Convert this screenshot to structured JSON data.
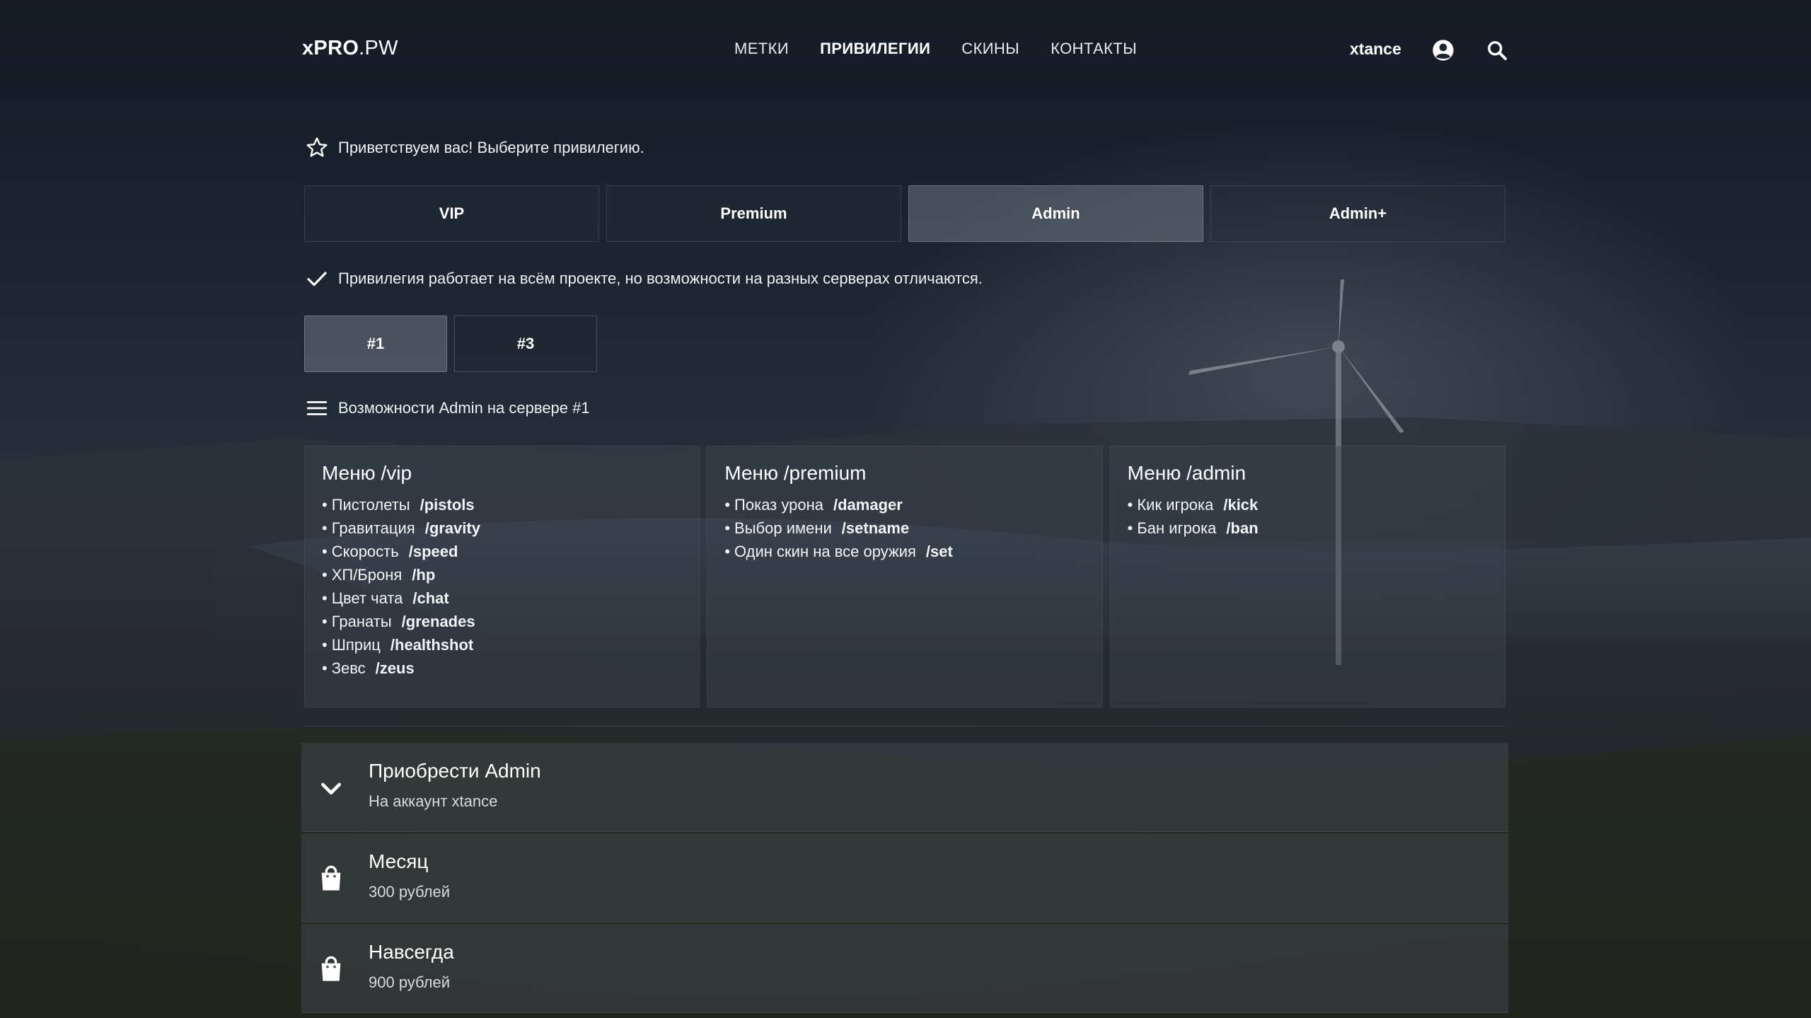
{
  "header": {
    "logo_bold": "xPRO",
    "logo_light": ".PW",
    "nav": [
      {
        "label": "МЕТКИ",
        "active": false
      },
      {
        "label": "ПРИВИЛЕГИИ",
        "active": true
      },
      {
        "label": "СКИНЫ",
        "active": false
      },
      {
        "label": "КОНТАКТЫ",
        "active": false
      }
    ],
    "username": "xtance",
    "user_icon": "account-circle-icon",
    "search_icon": "search-icon"
  },
  "greeting": {
    "icon": "star-outline-icon",
    "text": "Приветствуем вас! Выберите привилегию."
  },
  "tabs": [
    {
      "label": "VIP",
      "active": false
    },
    {
      "label": "Premium",
      "active": false
    },
    {
      "label": "Admin",
      "active": true
    },
    {
      "label": "Admin+",
      "active": false
    }
  ],
  "notice": {
    "icon": "checkmark-icon",
    "text": "Привилегия работает на всём проекте, но возможности на разных серверах отличаются."
  },
  "servers": [
    {
      "label": "#1",
      "active": true
    },
    {
      "label": "#3",
      "active": false
    }
  ],
  "features_heading": {
    "icon": "menu-icon",
    "text": "Возможности Admin на сервере #1"
  },
  "cards": [
    {
      "title": "Меню /vip",
      "items": [
        {
          "name": "Пистолеты",
          "cmd": "/pistols"
        },
        {
          "name": "Гравитация",
          "cmd": "/gravity"
        },
        {
          "name": "Скорость",
          "cmd": "/speed"
        },
        {
          "name": "ХП/Броня",
          "cmd": "/hp"
        },
        {
          "name": "Цвет чата",
          "cmd": "/chat"
        },
        {
          "name": "Гранаты",
          "cmd": "/grenades"
        },
        {
          "name": "Шприц",
          "cmd": "/healthshot"
        },
        {
          "name": "Зевс",
          "cmd": "/zeus"
        }
      ]
    },
    {
      "title": "Меню /premium",
      "items": [
        {
          "name": "Показ урона",
          "cmd": "/damager"
        },
        {
          "name": "Выбор имени",
          "cmd": "/setname"
        },
        {
          "name": "Один скин на все оружия",
          "cmd": "/set"
        }
      ]
    },
    {
      "title": "Меню /admin",
      "items": [
        {
          "name": "Кик игрока",
          "cmd": "/kick"
        },
        {
          "name": "Бан игрока",
          "cmd": "/ban"
        }
      ]
    }
  ],
  "purchase": {
    "header": {
      "icon": "chevron-down-icon",
      "title": "Приобрести Admin",
      "subtitle": "На аккаунт xtance"
    },
    "options": [
      {
        "icon": "shopping-bag-icon",
        "title": "Месяц",
        "price": "300 рублей"
      },
      {
        "icon": "shopping-bag-icon",
        "title": "Навсегда",
        "price": "900 рублей"
      }
    ]
  }
}
